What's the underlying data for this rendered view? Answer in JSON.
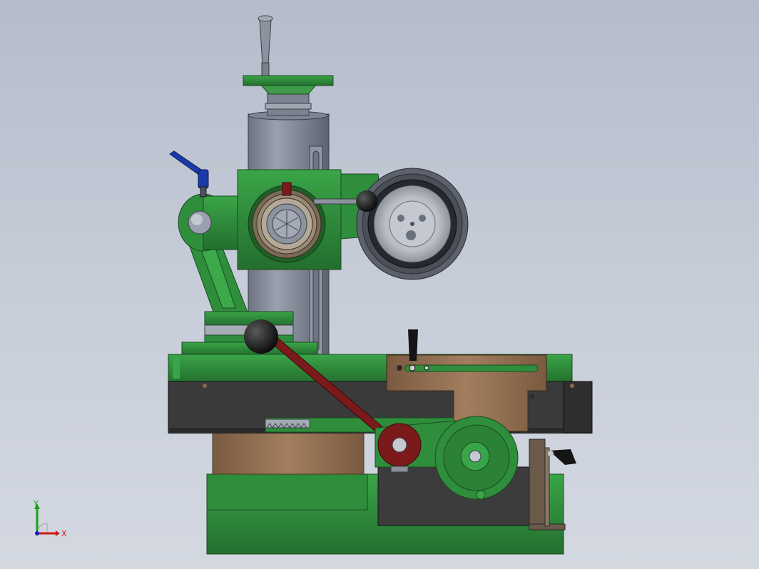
{
  "viewport": {
    "colors": {
      "machine_green": "#2e8a3a",
      "machine_green_dark": "#1f5e28",
      "steel_gray": "#8a909c",
      "dark_bed": "#3a3a3a",
      "bronze": "#8a6a4e",
      "lever_red": "#7a1a1a",
      "handle_blue": "#1a3aa8",
      "knob_black": "#151515"
    }
  },
  "triad": {
    "x_label": "X",
    "y_label": "Y",
    "x_color": "#d01818",
    "y_color": "#18a018",
    "z_color": "#1818c8"
  }
}
